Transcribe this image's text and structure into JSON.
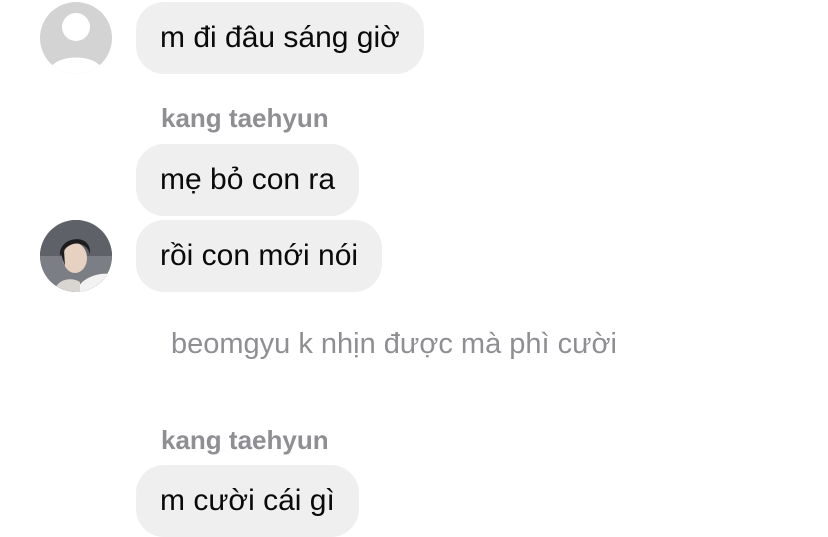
{
  "thread": {
    "messages": [
      {
        "text": "m đi đâu sáng giờ"
      },
      {
        "text": "mẹ bỏ con ra"
      },
      {
        "text": "rồi con mới nói"
      },
      {
        "text": "m cười cái gì"
      }
    ],
    "sender_names": [
      "kang taehyun",
      "kang taehyun"
    ],
    "notice": "beomgyu k nhịn được mà phì cười"
  },
  "colors": {
    "bubble_bg": "#efefef",
    "meta_text": "#8e8e93",
    "default_avatar_bg": "#d3d3d3"
  },
  "icons": {
    "default_avatar": "person-silhouette-icon",
    "photo_avatar": "user-photo"
  }
}
